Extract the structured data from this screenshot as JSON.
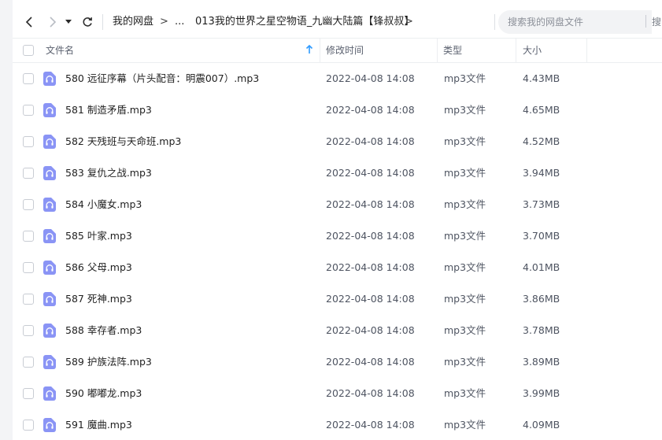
{
  "toolbar": {
    "breadcrumb": {
      "root": "我的网盘",
      "separator": ">",
      "ellipsis": "...",
      "current": "013我的世界之星空物语_九幽大陆篇【锋叔叔】",
      "trailing_separator": ">"
    },
    "search": {
      "placeholder": "搜索我的网盘文件",
      "more": "搜"
    }
  },
  "columns": {
    "name": "文件名",
    "modified": "修改时间",
    "type": "类型",
    "size": "大小"
  },
  "colors": {
    "accent": "#2f9bff",
    "icon": "#8a94f5"
  },
  "rows": [
    {
      "name": "580 远征序幕（片头配音：明震007）.mp3",
      "modified": "2022-04-08 14:08",
      "type": "mp3文件",
      "size": "4.43MB"
    },
    {
      "name": "581 制造矛盾.mp3",
      "modified": "2022-04-08 14:08",
      "type": "mp3文件",
      "size": "4.65MB"
    },
    {
      "name": "582 天残班与天命班.mp3",
      "modified": "2022-04-08 14:08",
      "type": "mp3文件",
      "size": "4.52MB"
    },
    {
      "name": "583 复仇之战.mp3",
      "modified": "2022-04-08 14:08",
      "type": "mp3文件",
      "size": "3.94MB"
    },
    {
      "name": "584 小魔女.mp3",
      "modified": "2022-04-08 14:08",
      "type": "mp3文件",
      "size": "3.73MB"
    },
    {
      "name": "585 叶家.mp3",
      "modified": "2022-04-08 14:08",
      "type": "mp3文件",
      "size": "3.70MB"
    },
    {
      "name": "586 父母.mp3",
      "modified": "2022-04-08 14:08",
      "type": "mp3文件",
      "size": "4.01MB"
    },
    {
      "name": "587 死神.mp3",
      "modified": "2022-04-08 14:08",
      "type": "mp3文件",
      "size": "3.86MB"
    },
    {
      "name": "588 幸存者.mp3",
      "modified": "2022-04-08 14:08",
      "type": "mp3文件",
      "size": "3.78MB"
    },
    {
      "name": "589 护族法阵.mp3",
      "modified": "2022-04-08 14:08",
      "type": "mp3文件",
      "size": "3.89MB"
    },
    {
      "name": "590 嘟嘟龙.mp3",
      "modified": "2022-04-08 14:08",
      "type": "mp3文件",
      "size": "3.99MB"
    },
    {
      "name": "591 魔曲.mp3",
      "modified": "2022-04-08 14:08",
      "type": "mp3文件",
      "size": "4.09MB"
    }
  ]
}
